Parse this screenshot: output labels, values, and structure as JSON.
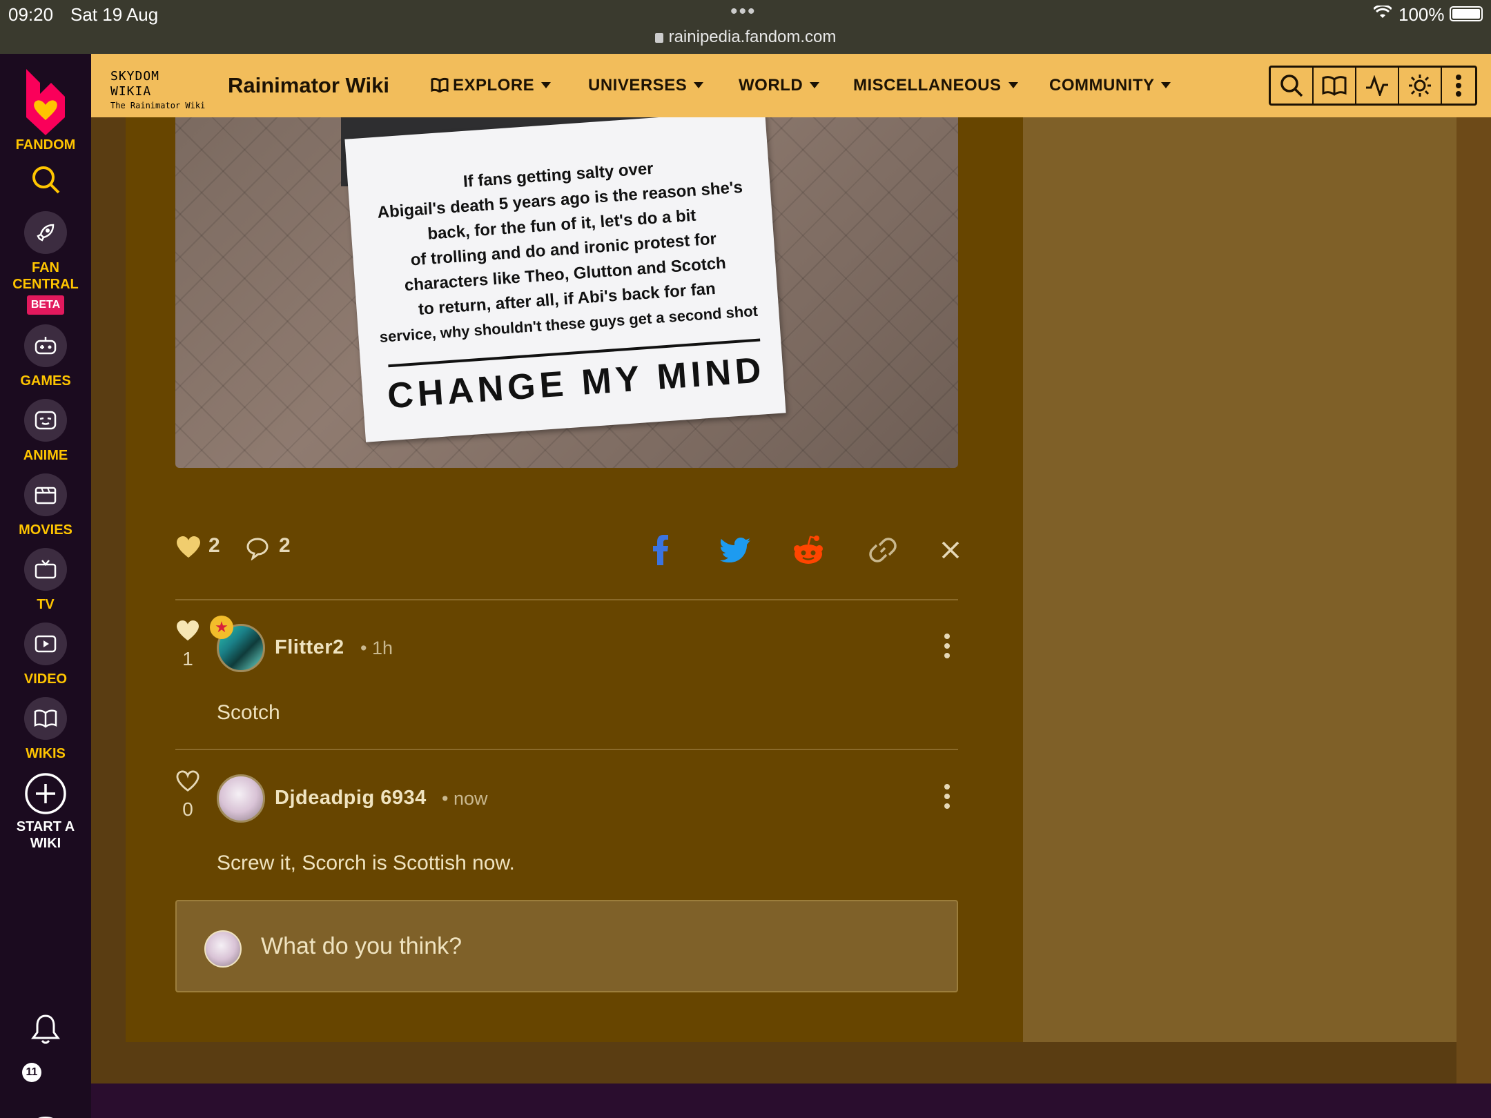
{
  "status_bar": {
    "time": "09:20",
    "date": "Sat 19 Aug",
    "url": "rainipedia.fandom.com",
    "battery": "100%"
  },
  "rail": {
    "brand": "FANDOM",
    "fan_central_line1": "FAN",
    "fan_central_line2": "CENTRAL",
    "beta": "BETA",
    "games": "GAMES",
    "anime": "ANIME",
    "movies": "MOVIES",
    "tv": "TV",
    "video": "VIDEO",
    "wikis": "WIKIS",
    "start_wiki_line1": "START A",
    "start_wiki_line2": "WIKI",
    "notification_count": "11"
  },
  "header": {
    "wordmark_line1": "SKYDOM WIKIA",
    "wordmark_line2": "The Rainimator Wiki",
    "title": "Rainimator Wiki",
    "nav": [
      "EXPLORE",
      "UNIVERSES",
      "WORLD",
      "MISCELLANEOUS",
      "COMMUNITY"
    ]
  },
  "meme": {
    "text_lines": [
      "If fans getting salty over",
      "Abigail's death 5 years ago is the reason she's",
      "back, for the fun of it, let's do a bit",
      "of trolling and do and ironic protest for",
      "characters like Theo, Glutton and Scotch",
      "to return, after all, if Abi's back for fan",
      "service, why shouldn't these guys get a second shot"
    ],
    "headline": "CHANGE MY MIND"
  },
  "post": {
    "likes": "2",
    "comments": "2"
  },
  "comments": [
    {
      "author": "Flitter2",
      "time": "1h",
      "likes": "1",
      "body": "Scotch"
    },
    {
      "author": "Djdeadpig 6934",
      "time": "now",
      "likes": "0",
      "body": "Screw it, Scorch is Scottish now."
    }
  ],
  "composer": {
    "placeholder": "What do you think?"
  },
  "colors": {
    "header_bg": "#f2bd5b",
    "rail_bg": "#1b0b1f",
    "rail_accent": "#ffc500",
    "content_bg": "#674500",
    "facebook": "#3b74e0",
    "twitter": "#1d9bf0",
    "reddit": "#ff4500"
  }
}
